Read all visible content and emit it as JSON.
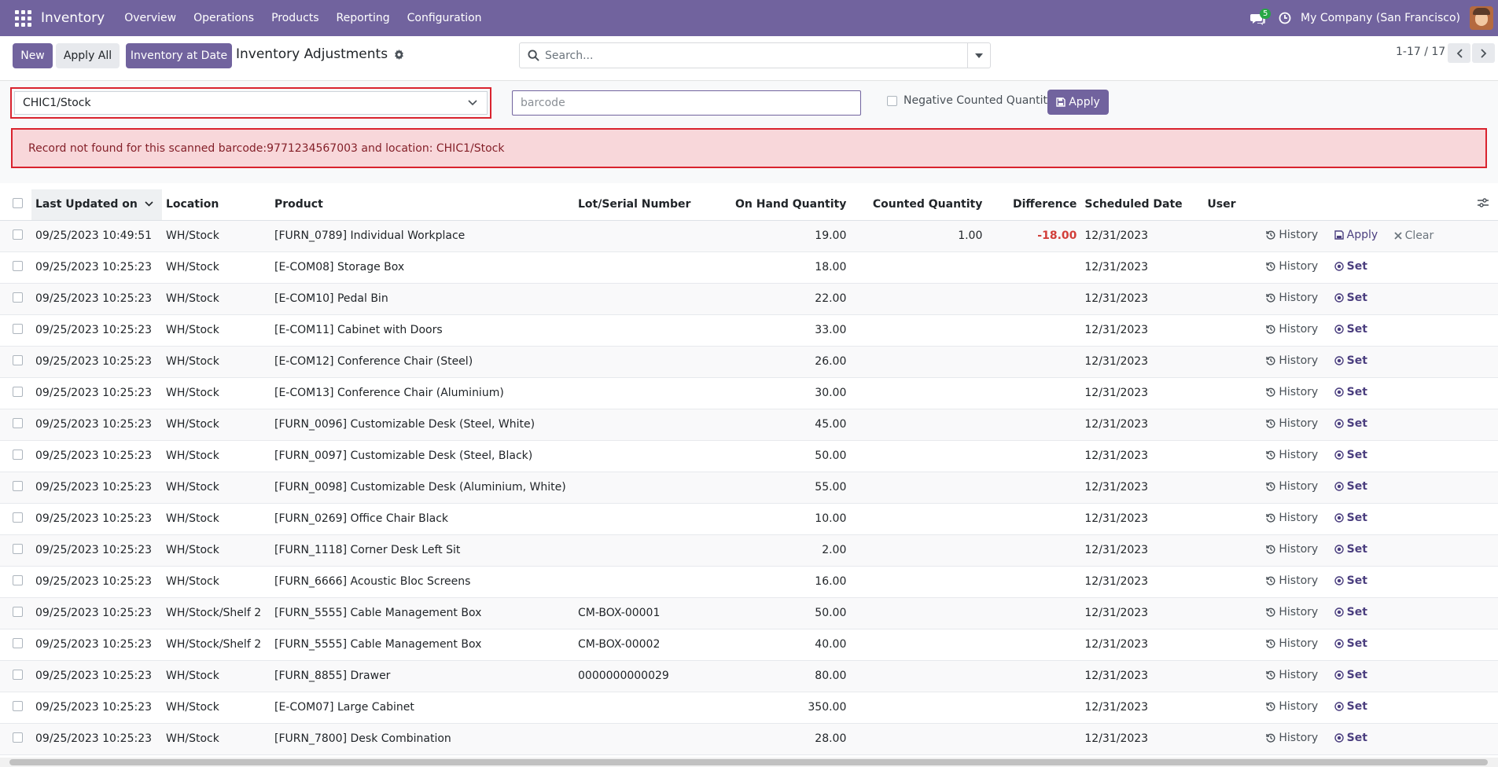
{
  "navbar": {
    "brand": "Inventory",
    "menu": [
      "Overview",
      "Operations",
      "Products",
      "Reporting",
      "Configuration"
    ],
    "messages_count": "5",
    "company": "My Company (San Francisco)"
  },
  "control_panel": {
    "new_label": "New",
    "apply_all_label": "Apply All",
    "inventory_at_date_label": "Inventory at Date",
    "title": "Inventory Adjustments",
    "search_placeholder": "Search...",
    "pager": "1-17 / 17"
  },
  "filters": {
    "location_value": "CHIC1/Stock",
    "barcode_placeholder": "barcode",
    "negative_label": "Negative Counted Quantity?",
    "apply_label": "Apply"
  },
  "alert": {
    "message": "Record not found for this scanned barcode:9771234567003 and location: CHIC1/Stock"
  },
  "table": {
    "headers": {
      "last_updated": "Last Updated on",
      "location": "Location",
      "product": "Product",
      "lot": "Lot/Serial Number",
      "on_hand": "On Hand Quantity",
      "counted": "Counted Quantity",
      "difference": "Difference",
      "scheduled": "Scheduled Date",
      "user": "User"
    },
    "action_labels": {
      "history": "History",
      "apply": "Apply",
      "clear": "Clear",
      "set": "Set"
    },
    "rows": [
      {
        "date": "09/25/2023 10:49:51",
        "location": "WH/Stock",
        "product": "[FURN_0789] Individual Workplace",
        "lot": "",
        "on_hand": "19.00",
        "counted": "1.00",
        "difference": "-18.00",
        "scheduled": "12/31/2023",
        "user": ""
      },
      {
        "date": "09/25/2023 10:25:23",
        "location": "WH/Stock",
        "product": "[E-COM08] Storage Box",
        "lot": "",
        "on_hand": "18.00",
        "counted": "",
        "difference": "",
        "scheduled": "12/31/2023",
        "user": ""
      },
      {
        "date": "09/25/2023 10:25:23",
        "location": "WH/Stock",
        "product": "[E-COM10] Pedal Bin",
        "lot": "",
        "on_hand": "22.00",
        "counted": "",
        "difference": "",
        "scheduled": "12/31/2023",
        "user": ""
      },
      {
        "date": "09/25/2023 10:25:23",
        "location": "WH/Stock",
        "product": "[E-COM11] Cabinet with Doors",
        "lot": "",
        "on_hand": "33.00",
        "counted": "",
        "difference": "",
        "scheduled": "12/31/2023",
        "user": ""
      },
      {
        "date": "09/25/2023 10:25:23",
        "location": "WH/Stock",
        "product": "[E-COM12] Conference Chair (Steel)",
        "lot": "",
        "on_hand": "26.00",
        "counted": "",
        "difference": "",
        "scheduled": "12/31/2023",
        "user": ""
      },
      {
        "date": "09/25/2023 10:25:23",
        "location": "WH/Stock",
        "product": "[E-COM13] Conference Chair (Aluminium)",
        "lot": "",
        "on_hand": "30.00",
        "counted": "",
        "difference": "",
        "scheduled": "12/31/2023",
        "user": ""
      },
      {
        "date": "09/25/2023 10:25:23",
        "location": "WH/Stock",
        "product": "[FURN_0096] Customizable Desk (Steel, White)",
        "lot": "",
        "on_hand": "45.00",
        "counted": "",
        "difference": "",
        "scheduled": "12/31/2023",
        "user": ""
      },
      {
        "date": "09/25/2023 10:25:23",
        "location": "WH/Stock",
        "product": "[FURN_0097] Customizable Desk (Steel, Black)",
        "lot": "",
        "on_hand": "50.00",
        "counted": "",
        "difference": "",
        "scheduled": "12/31/2023",
        "user": ""
      },
      {
        "date": "09/25/2023 10:25:23",
        "location": "WH/Stock",
        "product": "[FURN_0098] Customizable Desk (Aluminium, White)",
        "lot": "",
        "on_hand": "55.00",
        "counted": "",
        "difference": "",
        "scheduled": "12/31/2023",
        "user": ""
      },
      {
        "date": "09/25/2023 10:25:23",
        "location": "WH/Stock",
        "product": "[FURN_0269] Office Chair Black",
        "lot": "",
        "on_hand": "10.00",
        "counted": "",
        "difference": "",
        "scheduled": "12/31/2023",
        "user": ""
      },
      {
        "date": "09/25/2023 10:25:23",
        "location": "WH/Stock",
        "product": "[FURN_1118] Corner Desk Left Sit",
        "lot": "",
        "on_hand": "2.00",
        "counted": "",
        "difference": "",
        "scheduled": "12/31/2023",
        "user": ""
      },
      {
        "date": "09/25/2023 10:25:23",
        "location": "WH/Stock",
        "product": "[FURN_6666] Acoustic Bloc Screens",
        "lot": "",
        "on_hand": "16.00",
        "counted": "",
        "difference": "",
        "scheduled": "12/31/2023",
        "user": ""
      },
      {
        "date": "09/25/2023 10:25:23",
        "location": "WH/Stock/Shelf 2",
        "product": "[FURN_5555] Cable Management Box",
        "lot": "CM-BOX-00001",
        "on_hand": "50.00",
        "counted": "",
        "difference": "",
        "scheduled": "12/31/2023",
        "user": ""
      },
      {
        "date": "09/25/2023 10:25:23",
        "location": "WH/Stock/Shelf 2",
        "product": "[FURN_5555] Cable Management Box",
        "lot": "CM-BOX-00002",
        "on_hand": "40.00",
        "counted": "",
        "difference": "",
        "scheduled": "12/31/2023",
        "user": ""
      },
      {
        "date": "09/25/2023 10:25:23",
        "location": "WH/Stock",
        "product": "[FURN_8855] Drawer",
        "lot": "0000000000029",
        "on_hand": "80.00",
        "counted": "",
        "difference": "",
        "scheduled": "12/31/2023",
        "user": ""
      },
      {
        "date": "09/25/2023 10:25:23",
        "location": "WH/Stock",
        "product": "[E-COM07] Large Cabinet",
        "lot": "",
        "on_hand": "350.00",
        "counted": "",
        "difference": "",
        "scheduled": "12/31/2023",
        "user": ""
      },
      {
        "date": "09/25/2023 10:25:23",
        "location": "WH/Stock",
        "product": "[FURN_7800] Desk Combination",
        "lot": "",
        "on_hand": "28.00",
        "counted": "",
        "difference": "",
        "scheduled": "12/31/2023",
        "user": ""
      }
    ]
  },
  "colors": {
    "brand": "#71639e",
    "alert_bg": "#f8d7da",
    "alert_border": "#d9232e",
    "negative": "#d23f3a"
  }
}
